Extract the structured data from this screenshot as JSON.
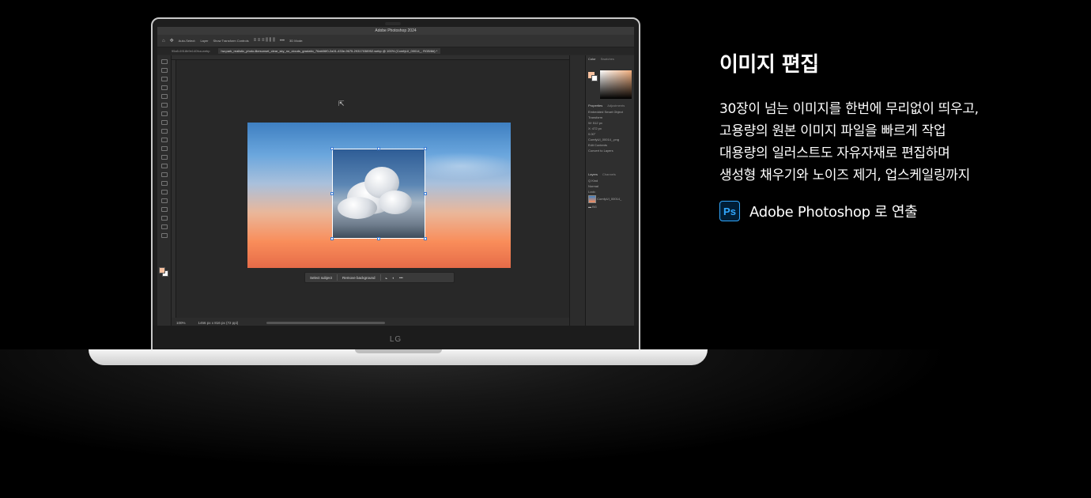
{
  "marketing": {
    "headline": "이미지 편집",
    "body_lines": [
      "30장이 넘는 이미지를 한번에 무리없이 띄우고,",
      "고용량의 원본 이미지 파일을 빠르게 작업",
      "대용량의 일러스트도 자유자재로 편집하며",
      "생성형 채우기와 노이즈 제거, 업스케일링까지"
    ],
    "app_badge": "Ps",
    "app_label": "Adobe Photoshop 로 연출"
  },
  "laptop": {
    "brand": "LG"
  },
  "photoshop": {
    "window_title": "Adobe Photoshop 2024",
    "options": {
      "auto_select": "Auto-Select:",
      "auto_select_value": "Layer",
      "show_transform": "Show Transform Controls",
      "mode_3d": "3D Mode:"
    },
    "tabs": [
      "95a5-6918b9e140fca.webp",
      "hw.park_realistic_photo-likesunset_clear_sky_no_clouds_gradatio_76ab06f0-2a31-433e-9675-29317038952.webp @ 100% (ComfyUI_00014_, RGB/8#) *"
    ],
    "context_bar": {
      "select_subject": "Select subject",
      "remove_background": "Remove background"
    },
    "status": {
      "zoom": "100%",
      "doc_size": "1456 px x 816 px (72 ppi)"
    },
    "panel": {
      "color_tab": "Color",
      "swatches_tab": "Swatches",
      "properties_tab": "Properties",
      "adjustments_tab": "Adjustments",
      "embedded": "Embedded Smart Object",
      "transform": "Transform",
      "w_value": "W: 512 px",
      "x_value": "X: 472 px",
      "angle": "0.00°",
      "layer_file": "ComfyUI_00014_.png",
      "edit_contents": "Edit Contents",
      "convert": "Convert to Layers",
      "layers_tab": "Layers",
      "channels_tab": "Channels",
      "kind": "Q Kind",
      "blend": "Normal",
      "lock": "Lock:",
      "layer1": "ComfyUI_00014_",
      "layer2": "BG"
    },
    "colors": {
      "foreground": "#f7c19f",
      "accent": "#31a8ff"
    }
  }
}
